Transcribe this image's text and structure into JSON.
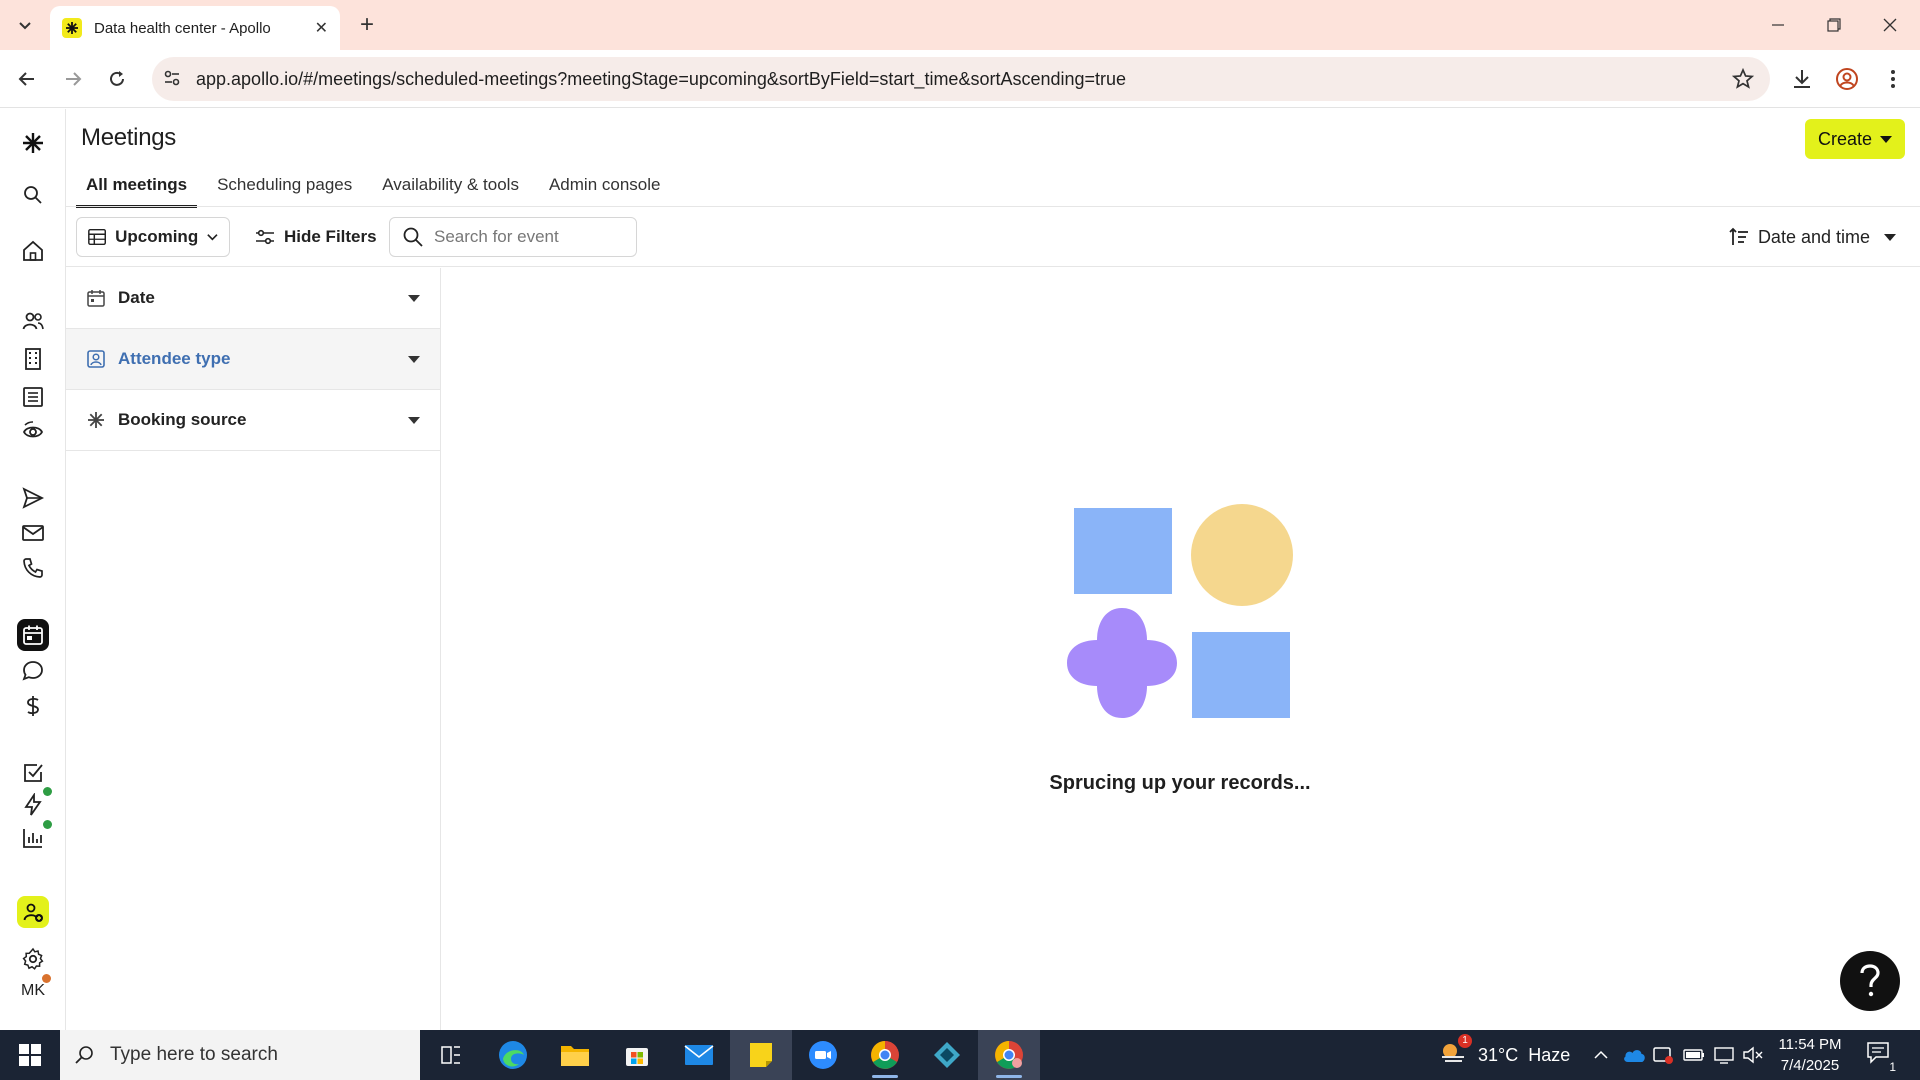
{
  "browser": {
    "tab_title": "Data health center - Apollo",
    "url": "app.apollo.io/#/meetings/scheduled-meetings?meetingStage=upcoming&sortByField=start_time&sortAscending=true"
  },
  "header": {
    "title": "Meetings",
    "create_label": "Create",
    "accent_color": "#e3f11b"
  },
  "tabs": [
    {
      "label": "All meetings",
      "active": true
    },
    {
      "label": "Scheduling pages",
      "active": false
    },
    {
      "label": "Availability & tools",
      "active": false
    },
    {
      "label": "Admin console",
      "active": false
    }
  ],
  "filterbar": {
    "view_label": "Upcoming",
    "hide_filters_label": "Hide Filters",
    "search_placeholder": "Search for event",
    "sort_label": "Date and time"
  },
  "filters": [
    {
      "label": "Date",
      "icon": "calendar-icon"
    },
    {
      "label": "Attendee type",
      "icon": "person-badge-icon",
      "highlighted": true
    },
    {
      "label": "Booking source",
      "icon": "apollo-logo-icon"
    }
  ],
  "main": {
    "loading_text": "Sprucing up your records..."
  },
  "sidebar": {
    "avatar_initials": "MK"
  },
  "taskbar": {
    "search_placeholder": "Type here to search",
    "weather": "31°C  Haze",
    "time": "11:54 PM",
    "date": "7/4/2025",
    "notification_count": "1",
    "weather_badge": "1"
  }
}
